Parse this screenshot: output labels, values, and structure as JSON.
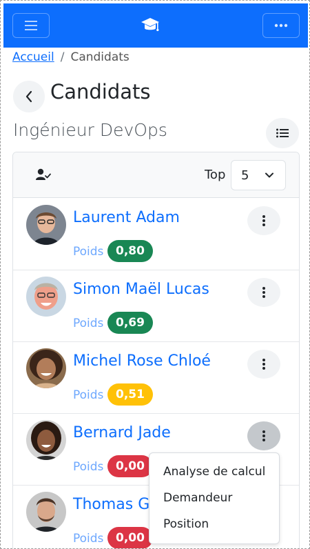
{
  "header": {
    "menu_icon": "hamburger-icon",
    "logo_icon": "graduation-cap-icon",
    "more_icon": "ellipsis-icon"
  },
  "breadcrumb": {
    "home": "Accueil",
    "separator": "/",
    "current": "Candidats"
  },
  "page": {
    "title": "Candidats",
    "subtitle": "Ingénieur DevOps"
  },
  "toolbar": {
    "top_label": "Top",
    "top_value": "5"
  },
  "candidates": [
    {
      "name": "Laurent Adam",
      "poids_label": "Poids",
      "score": "0,80",
      "score_color": "#198754"
    },
    {
      "name": "Simon Maël Lucas",
      "poids_label": "Poids",
      "score": "0,69",
      "score_color": "#198754"
    },
    {
      "name": "Michel Rose Chloé",
      "poids_label": "Poids",
      "score": "0,51",
      "score_color": "#ffc107"
    },
    {
      "name": "Bernard Jade",
      "poids_label": "Poids",
      "score": "0,00",
      "score_color": "#dc3545"
    },
    {
      "name": "Thomas Ga",
      "poids_label": "Poids",
      "score": "0,00",
      "score_color": "#dc3545"
    }
  ],
  "dropdown_menu": {
    "items": [
      "Analyse de calcul",
      "Demandeur",
      "Position"
    ]
  },
  "colors": {
    "primary": "#0d6efd",
    "success": "#198754",
    "warning": "#ffc107",
    "danger": "#dc3545"
  }
}
